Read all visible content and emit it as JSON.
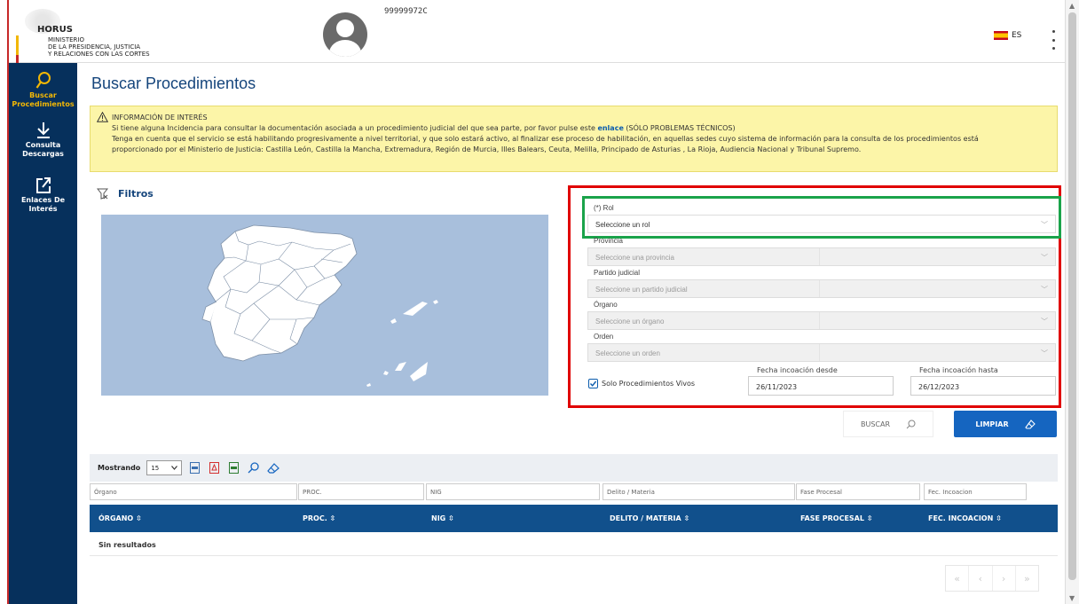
{
  "header": {
    "logo_title": "HORUS",
    "ministry_line1": "MINISTERIO",
    "ministry_line2": "DE LA PRESIDENCIA, JUSTICIA",
    "ministry_line3": "Y RELACIONES CON LAS CORTES",
    "user_id": "99999972C",
    "language": "ES"
  },
  "sidebar": {
    "items": [
      {
        "label_1": "Buscar",
        "label_2": "Procedimientos",
        "icon": "search-icon",
        "active": true
      },
      {
        "label_1": "Consulta",
        "label_2": "Descargas",
        "icon": "download-icon",
        "active": false
      },
      {
        "label_1": "Enlaces De Interés",
        "icon": "external-link-icon",
        "active": false
      }
    ]
  },
  "page": {
    "title": "Buscar Procedimientos"
  },
  "info": {
    "title": "INFORMACIÓN DE INTERÉS",
    "line1_pre": "Si tiene alguna Incidencia para consultar la documentación asociada a un procedimiento judicial del que sea parte, por favor pulse este",
    "link": "enlace",
    "line1_post": "(SÓLO PROBLEMAS TÉCNICOS)",
    "line2": "Tenga en cuenta que el servicio se está habilitando progresivamente a nivel territorial, y que solo estará activo, al finalizar ese proceso de habilitación, en aquellas sedes cuyo sistema de información para la consulta de los procedimientos está",
    "line3": "proporcionado por el Ministerio de Justicia: Castilla León, Castilla la Mancha, Extremadura, Región de Murcia, Illes Balears, Ceuta, Melilla, Principado de Asturias , La Rioja, Audiencia Nacional y Tribunal Supremo."
  },
  "filters": {
    "title": "Filtros",
    "rol_label": "(*) Rol",
    "rol_placeholder": "Seleccione un rol",
    "provincia_label": "Provincia",
    "provincia_placeholder": "Seleccione una provincia",
    "partido_label": "Partido judicial",
    "partido_placeholder": "Seleccione un partido judicial",
    "organo_label": "Órgano",
    "organo_placeholder": "Seleccione un órgano",
    "orden_label": "Orden",
    "orden_placeholder": "Seleccione un orden",
    "vivos_label": "Solo Procedimientos Vivos",
    "vivos_checked": true,
    "fecha_desde_label": "Fecha incoación desde",
    "fecha_desde_value": "26/11/2023",
    "fecha_hasta_label": "Fecha incoación hasta",
    "fecha_hasta_value": "26/12/2023",
    "buscar_label": "BUSCAR",
    "limpiar_label": "LIMPIAR"
  },
  "table": {
    "showing_label": "Mostrando",
    "page_size": "15",
    "filter_placeholders": [
      "Órgano",
      "PROC.",
      "NIG",
      "Delito / Materia",
      "Fase Procesal",
      "Fec. Incoacion"
    ],
    "headers": [
      "ÓRGANO",
      "PROC.",
      "NIG",
      "DELITO / MATERIA",
      "FASE PROCESAL",
      "FEC. INCOACION"
    ],
    "sort_glyph": "⇳",
    "empty_message": "Sin resultados",
    "pager": [
      "«",
      "‹",
      "›",
      "»"
    ]
  },
  "colors": {
    "brand_blue": "#15457c",
    "nav_bg": "#06305c",
    "accent_yellow": "#f2b705",
    "info_bg": "#fcf5a8",
    "highlight_red": "#e00000",
    "highlight_green": "#1aa34a",
    "button_blue": "#1565c0"
  }
}
